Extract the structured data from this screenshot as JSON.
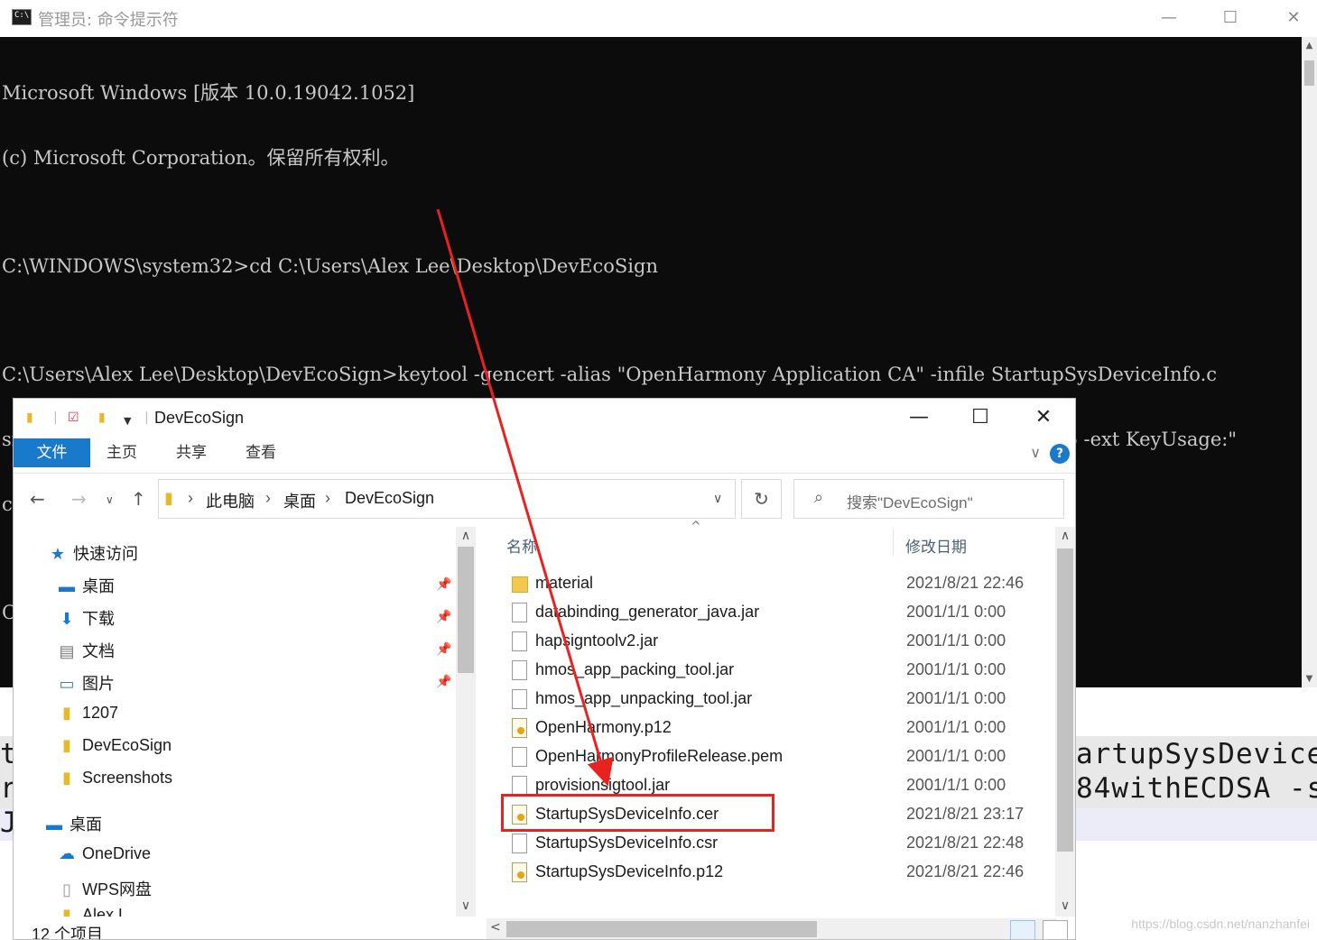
{
  "cmd": {
    "title": "管理员: 命令提示符",
    "lines": [
      "Microsoft Windows [版本 10.0.19042.1052]",
      "(c) Microsoft Corporation。保留所有权利。",
      "",
      "C:\\WINDOWS\\system32>cd C:\\Users\\Alex Lee\\Desktop\\DevEcoSign",
      "",
      "C:\\Users\\Alex Lee\\Desktop\\DevEcoSign>keytool -gencert -alias \"OpenHarmony Application CA\" -infile StartupSysDeviceInfo.c",
      "sr -outfile StartupSysDeviceInfo.cer -keystore OpenHarmony.p12 -sigalg SHA384withECDSA -storepass 123456 -ext KeyUsage:\"",
      "critical=digitalSignature\" -validity  3650 -rfc",
      "",
      "C:\\Users\\Alex Lee\\Desktop\\DevEcoSign>"
    ],
    "minimize": "—",
    "maximize": "☐",
    "close": "✕"
  },
  "background_doc": {
    "line1_left": "t",
    "line1_right": "artupSysDevice",
    "line2_left": "r",
    "line2_right": "84withECDSA -s",
    "line3_left": "J"
  },
  "watermark": "https://blog.csdn.net/nanzhanfei",
  "explorer": {
    "title": "DevEcoSign",
    "window_buttons": {
      "minimize": "—",
      "maximize": "☐",
      "close": "✕"
    },
    "ribbon_tabs": [
      "文件",
      "主页",
      "共享",
      "查看"
    ],
    "help": "?",
    "breadcrumb": [
      "此电脑",
      "桌面",
      "DevEcoSign"
    ],
    "search_placeholder": "搜索\"DevEcoSign\"",
    "nav": {
      "quick_access": "快速访问",
      "items": [
        "桌面",
        "下载",
        "文档",
        "图片",
        "1207",
        "DevEcoSign",
        "Screenshots"
      ],
      "desktop": "桌面",
      "onedrive": "OneDrive",
      "wps": "WPS网盘",
      "partial": "Alex L"
    },
    "columns": {
      "name": "名称",
      "date": "修改日期"
    },
    "files": [
      {
        "name": "material",
        "date": "2021/8/21 22:46",
        "icon": "folder-icon"
      },
      {
        "name": "databinding_generator_java.jar",
        "date": "2001/1/1 0:00",
        "icon": "file-icon"
      },
      {
        "name": "hapsigntoolv2.jar",
        "date": "2001/1/1 0:00",
        "icon": "file-icon"
      },
      {
        "name": "hmos_app_packing_tool.jar",
        "date": "2001/1/1 0:00",
        "icon": "file-icon"
      },
      {
        "name": "hmos_app_unpacking_tool.jar",
        "date": "2001/1/1 0:00",
        "icon": "file-icon"
      },
      {
        "name": "OpenHarmony.p12",
        "date": "2001/1/1 0:00",
        "icon": "certificate-icon"
      },
      {
        "name": "OpenHarmonyProfileRelease.pem",
        "date": "2001/1/1 0:00",
        "icon": "file-icon"
      },
      {
        "name": "provisionsigtool.jar",
        "date": "2001/1/1 0:00",
        "icon": "file-icon"
      },
      {
        "name": "StartupSysDeviceInfo.cer",
        "date": "2021/8/21 23:17",
        "icon": "certificate-icon"
      },
      {
        "name": "StartupSysDeviceInfo.csr",
        "date": "2021/8/21 22:48",
        "icon": "file-icon"
      },
      {
        "name": "StartupSysDeviceInfo.p12",
        "date": "2021/8/21 22:46",
        "icon": "certificate-icon"
      }
    ],
    "status": "12 个项目"
  },
  "annotation_color": "#e8231f"
}
